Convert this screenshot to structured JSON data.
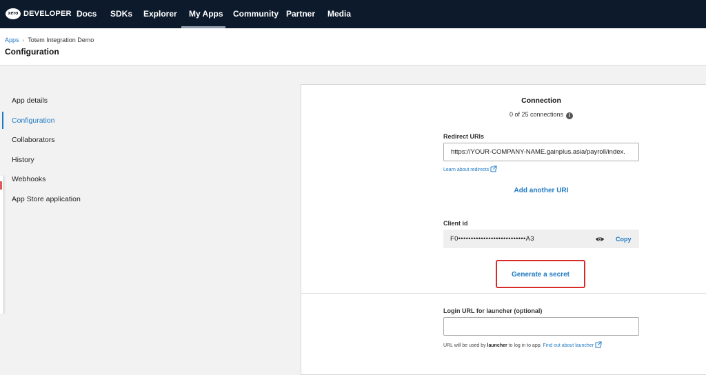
{
  "nav": {
    "logo_text": "xero",
    "brand": "DEVELOPER",
    "items": [
      "Docs",
      "SDKs",
      "Explorer",
      "My Apps",
      "Community",
      "Partner",
      "Media"
    ]
  },
  "breadcrumb": {
    "root": "Apps",
    "separator": "›",
    "current": "Totem Integration Demo"
  },
  "page_title": "Configuration",
  "sidebar": {
    "items": [
      "App details",
      "Configuration",
      "Collaborators",
      "History",
      "Webhooks",
      "App Store application"
    ]
  },
  "connection": {
    "title": "Connection",
    "count": "0 of 25 connections",
    "info_glyph": "i"
  },
  "redirect": {
    "label": "Redirect URIs",
    "value": "https://YOUR-COMPANY-NAME.gainplus.asia/payroll/index.",
    "learn_link": "Learn about redirects",
    "add_label": "Add another URI"
  },
  "client": {
    "label": "Client id",
    "value": "F0•••••••••••••••••••••••••••A3",
    "copy_label": "Copy"
  },
  "secret": {
    "button_label": "Generate a secret"
  },
  "launcher": {
    "label": "Login URL for launcher (optional)",
    "value": "",
    "help_prefix": "URL will be used by ",
    "help_bold": "launcher",
    "help_middle": " to log in to app. ",
    "help_link": "Find out about launcher"
  },
  "colors": {
    "nav_bg": "#0c1a2b",
    "accent": "#1e79c4",
    "highlight": "#d92a2a"
  }
}
